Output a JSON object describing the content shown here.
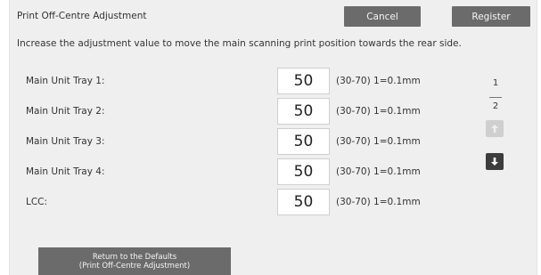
{
  "header": {
    "title": "Print Off-Centre Adjustment",
    "cancel_label": "Cancel",
    "register_label": "Register"
  },
  "instruction": "Increase the adjustment value to move the main scanning print position towards the rear side.",
  "rows": [
    {
      "label": "Main Unit Tray 1:",
      "value": "50",
      "range": "(30-70) 1=0.1mm"
    },
    {
      "label": "Main Unit Tray 2:",
      "value": "50",
      "range": "(30-70) 1=0.1mm"
    },
    {
      "label": "Main Unit Tray 3:",
      "value": "50",
      "range": "(30-70) 1=0.1mm"
    },
    {
      "label": "Main Unit Tray 4:",
      "value": "50",
      "range": "(30-70) 1=0.1mm"
    },
    {
      "label": "LCC:",
      "value": "50",
      "range": "(30-70) 1=0.1mm"
    }
  ],
  "pager": {
    "current": "1",
    "total": "2",
    "up_icon": "arrow-up-icon",
    "down_icon": "arrow-down-icon"
  },
  "footer": {
    "defaults_line1": "Return to the Defaults",
    "defaults_line2": "(Print Off-Centre Adjustment)"
  }
}
